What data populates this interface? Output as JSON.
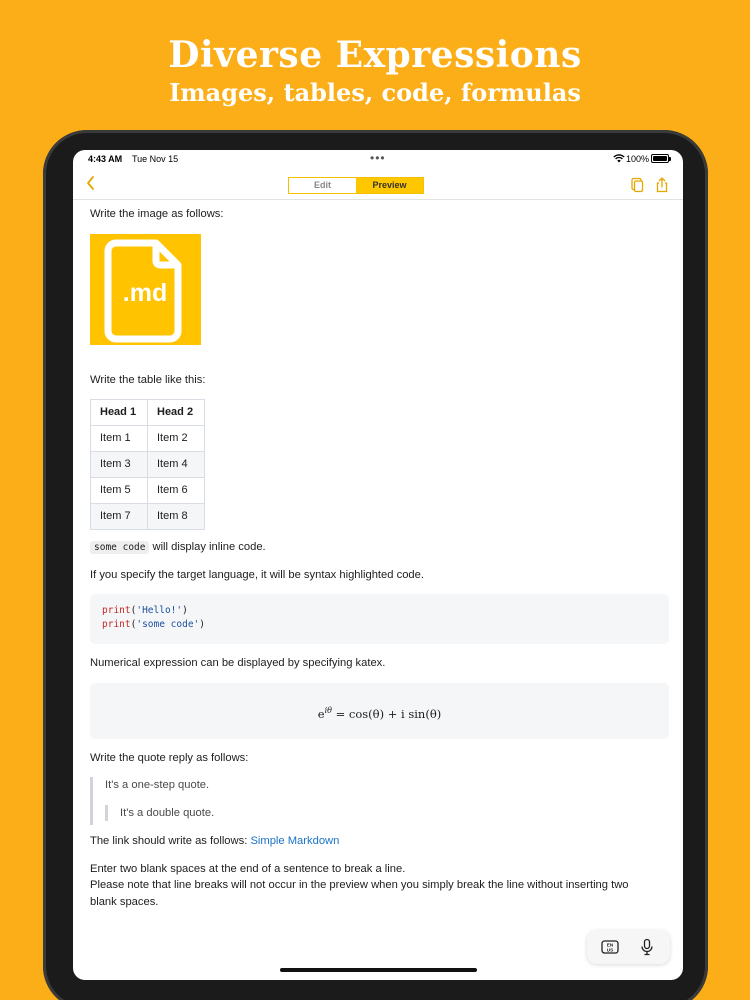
{
  "promo": {
    "title": "Diverse Expressions",
    "subtitle": "Images, tables, code, formulas"
  },
  "status_bar": {
    "time": "4:43 AM",
    "date": "Tue Nov 15",
    "more_indicator": "•••",
    "battery": "100%",
    "wifi_icon": "wifi-icon",
    "battery_icon": "battery-icon"
  },
  "nav": {
    "back_icon": "chevron-left-icon",
    "segments": {
      "edit": "Edit",
      "preview": "Preview",
      "selected": "Preview"
    },
    "copy_icon": "copy-icon",
    "share_icon": "share-icon",
    "accent_color": "#FFC700"
  },
  "content": {
    "image_intro": "Write the image as follows:",
    "image_label": ".md",
    "table_intro": "Write the table like this:",
    "table": {
      "headers": [
        "Head 1",
        "Head 2"
      ],
      "rows": [
        [
          "Item 1",
          "Item 2"
        ],
        [
          "Item 3",
          "Item 4"
        ],
        [
          "Item 5",
          "Item 6"
        ],
        [
          "Item 7",
          "Item 8"
        ]
      ]
    },
    "inline_code": "some code",
    "inline_code_suffix": "will display inline code.",
    "syntax_intro": "If you specify the target language, it will be syntax highlighted code.",
    "code_lines": [
      {
        "fn": "print",
        "open": "(",
        "str": "'Hello!'",
        "close": ")"
      },
      {
        "fn": "print",
        "open": "(",
        "str": "'some code'",
        "close": ")"
      }
    ],
    "math_intro": "Numerical expression can be displayed by specifying katex.",
    "math_expression": "= cos(θ) + i sin(θ)",
    "math_base": "e",
    "math_exponent": "iθ",
    "quote_intro": "Write the quote reply as follows:",
    "quote_one": "It's a one-step quote.",
    "quote_two": "It's a double quote.",
    "link_intro": "The link should write as follows:",
    "link_text": "Simple Markdown",
    "linebreak_line1": "Enter two blank spaces at the end of a sentence to break a line.",
    "linebreak_line2": "Please note that line breaks will not occur in the preview when you simply break the line without inserting two",
    "linebreak_line3": "blank spaces."
  },
  "floating_toolbar": {
    "keyboard_label": "EN US",
    "keyboard_icon": "keyboard-language-icon",
    "mic_icon": "microphone-icon"
  },
  "colors": {
    "background": "#FBAE17",
    "accent": "#FFC700",
    "link": "#1a73c7"
  }
}
